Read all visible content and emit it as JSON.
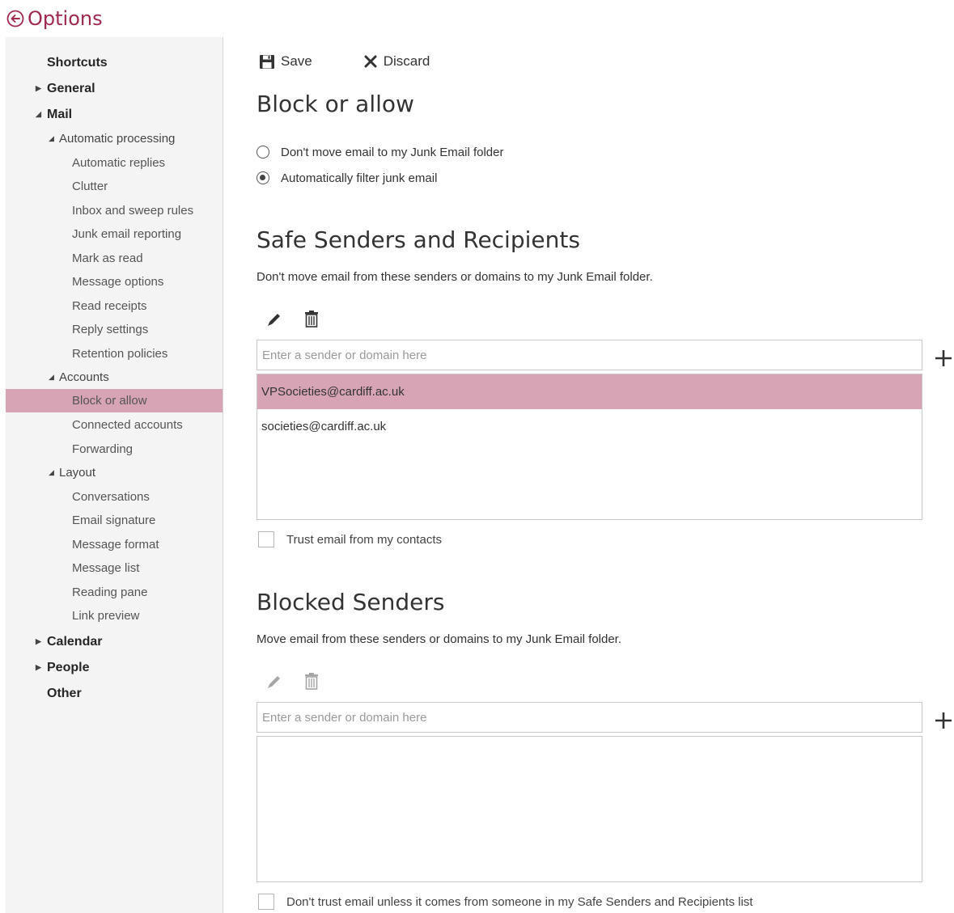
{
  "header": {
    "title": "Options",
    "back_icon": "back-arrow-circle-icon"
  },
  "nav": {
    "shortcuts": "Shortcuts",
    "general": "General",
    "mail": "Mail",
    "automatic_processing": "Automatic processing",
    "automatic_replies": "Automatic replies",
    "clutter": "Clutter",
    "inbox_sweep": "Inbox and sweep rules",
    "junk_reporting": "Junk email reporting",
    "mark_as_read": "Mark as read",
    "message_options": "Message options",
    "read_receipts": "Read receipts",
    "reply_settings": "Reply settings",
    "retention_policies": "Retention policies",
    "accounts": "Accounts",
    "block_or_allow": "Block or allow",
    "connected_accounts": "Connected accounts",
    "forwarding": "Forwarding",
    "layout": "Layout",
    "conversations": "Conversations",
    "email_signature": "Email signature",
    "message_format": "Message format",
    "message_list": "Message list",
    "reading_pane": "Reading pane",
    "link_preview": "Link preview",
    "calendar": "Calendar",
    "people": "People",
    "other": "Other",
    "selected": "Block or allow"
  },
  "toolbar": {
    "save_label": "Save",
    "discard_label": "Discard"
  },
  "block_or_allow": {
    "title": "Block or allow",
    "option_dont_move": "Don't move email to my Junk Email folder",
    "option_auto_filter": "Automatically filter junk email",
    "selected_option": "Automatically filter junk email"
  },
  "safe_senders": {
    "title": "Safe Senders and Recipients",
    "description": "Don't move email from these senders or domains to my Junk Email folder.",
    "input_placeholder": "Enter a sender or domain here",
    "items": [
      "VPSocieties@cardiff.ac.uk",
      "societies@cardiff.ac.uk"
    ],
    "selected_item": "VPSocieties@cardiff.ac.uk",
    "trust_contacts_label": "Trust email from my contacts",
    "trust_contacts_checked": false
  },
  "blocked_senders": {
    "title": "Blocked Senders",
    "description": "Move email from these senders or domains to my Junk Email folder.",
    "input_placeholder": "Enter a sender or domain here",
    "items": [],
    "dont_trust_label": "Don't trust email unless it comes from someone in my Safe Senders and Recipients list",
    "dont_trust_checked": false
  },
  "colors": {
    "accent": "#a0294e",
    "selection": "#d6a4b4",
    "sidebar_bg": "#f4f4f4"
  }
}
